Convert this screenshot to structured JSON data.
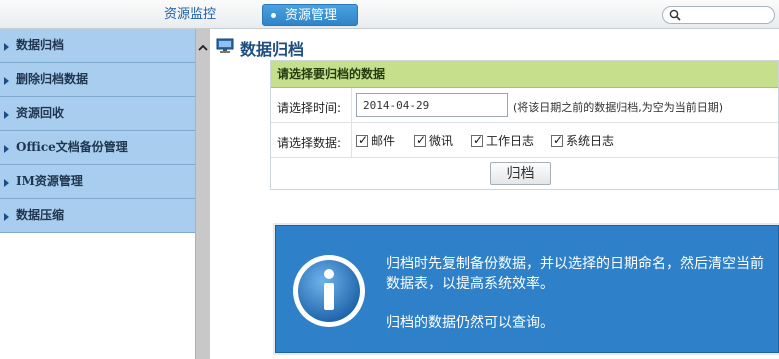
{
  "topbar": {
    "tabs": [
      {
        "label": "资源监控",
        "active": false
      },
      {
        "label": "资源管理",
        "active": true
      }
    ],
    "search": {
      "placeholder": "",
      "value": ""
    }
  },
  "sidebar": {
    "items": [
      {
        "label": "数据归档"
      },
      {
        "label": "删除归档数据"
      },
      {
        "label": "资源回收"
      },
      {
        "label": "Office文档备份管理"
      },
      {
        "label": "IM资源管理"
      },
      {
        "label": "数据压缩"
      }
    ]
  },
  "main": {
    "title": "数据归档",
    "form": {
      "header": "请选择要归档的数据",
      "time_label": "请选择时间:",
      "date_value": "2014-04-29",
      "date_hint": "(将该日期之前的数据归档,为空为当前日期)",
      "data_label": "请选择数据:",
      "options": [
        {
          "label": "邮件",
          "checked": true
        },
        {
          "label": "微讯",
          "checked": true
        },
        {
          "label": "工作日志",
          "checked": true
        },
        {
          "label": "系统日志",
          "checked": true
        }
      ],
      "submit_label": "归档"
    },
    "info": {
      "line1": "归档时先复制备份数据，并以选择的日期命名，然后清空当前数据表，以提高系统效率。",
      "line2": "归档的数据仍然可以查询。"
    }
  },
  "colors": {
    "sidebar_bg": "#a8cdee",
    "active_tab": "#2f84c8",
    "form_header": "#c5df8c",
    "info_panel": "#2e80c8"
  },
  "icons": [
    "search-icon",
    "sidebar-arrow-icon",
    "collapse-up-icon",
    "monitor-icon",
    "info-icon",
    "checkbox-checked-icon"
  ]
}
